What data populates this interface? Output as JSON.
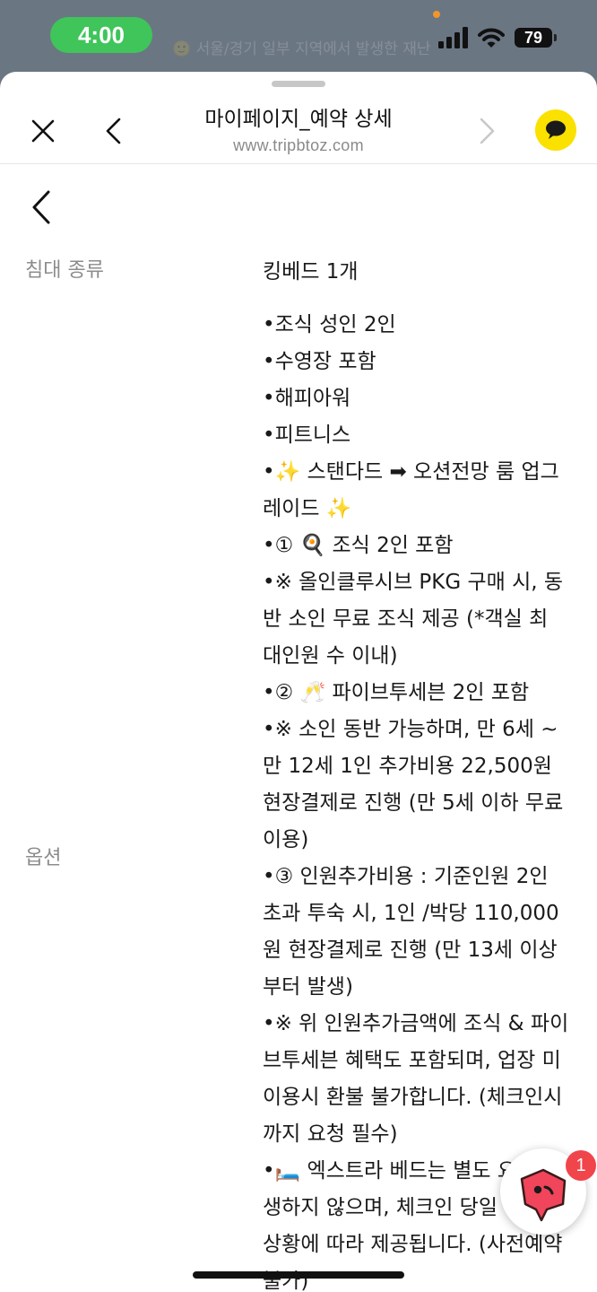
{
  "status_bar": {
    "time": "4:00",
    "battery": "79",
    "faded_notice": "🙂 서울/경기 일부 지역에서 발생한 재난"
  },
  "browser": {
    "title": "마이페이지_예약 상세",
    "url": "www.tripbtoz.com"
  },
  "reservation": {
    "bed_label": "침대 종류",
    "bed_value": "킹베드 1개",
    "option_label": "옵션",
    "option_lines": [
      "•조식 성인 2인",
      "•수영장 포함",
      "•해피아워",
      "•피트니스",
      "•✨ 스탠다드 ➡ 오션전망 룸 업그",
      "레이드 ✨",
      "•① 🍳 조식 2인 포함",
      "•※ 올인클루시브 PKG 구매 시, 동",
      "반 소인 무료 조식 제공 (*객실 최",
      "대인원 수 이내)",
      "•② 🥂 파이브투세븐 2인 포함",
      "•※ 소인 동반 가능하며, 만 6세 ~",
      "만 12세 1인 추가비용 22,500원",
      "현장결제로 진행 (만 5세 이하 무료",
      "이용)",
      "•③ 인원추가비용 : 기준인원 2인",
      "초과 투숙 시, 1인 /박당 110,000",
      "원 현장결제로 진행 (만 13세 이상",
      "부터 발생)",
      "•※ 위 인원추가금액에 조식 & 파이",
      "브투세븐 혜택도 포함되며, 업장 미",
      "이용시 환불 불가합니다. (체크인시",
      "까지 요청 필수)",
      "•🛏️ 엑스트라 베드는 별도 요금이 발",
      "생하지 않으며, 체크인 당일 객실",
      "상황에 따라 제공됩니다. (사전예약",
      "불가)"
    ]
  },
  "chat": {
    "badge": "1"
  },
  "colors": {
    "status_pill": "#3fc55a",
    "kakao_yellow": "#fae100",
    "chat_pink": "#f0455a",
    "badge_red": "#f0454b"
  }
}
